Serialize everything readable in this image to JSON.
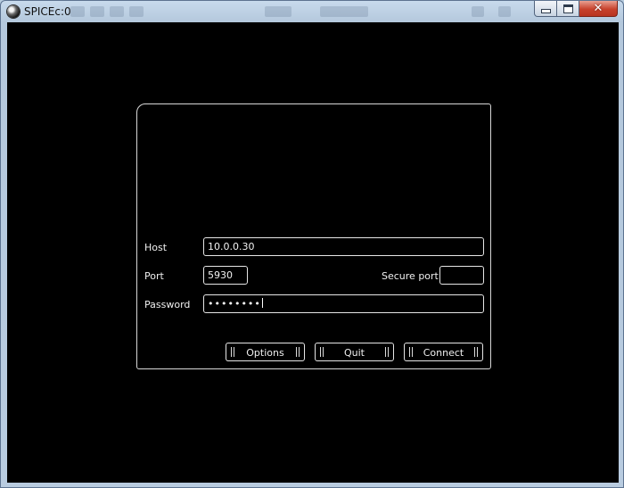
{
  "window": {
    "title": "SPICEc:0"
  },
  "dialog": {
    "host": {
      "label": "Host",
      "value": "10.0.0.30"
    },
    "port": {
      "label": "Port",
      "value": "5930"
    },
    "secure_port": {
      "label": "Secure port",
      "value": ""
    },
    "password": {
      "label": "Password",
      "masked_value": "••••••••"
    },
    "buttons": {
      "options": "Options",
      "quit": "Quit",
      "connect": "Connect"
    }
  },
  "icons": {
    "app": "spice-app-icon",
    "minimize": "minimize-icon",
    "maximize": "maximize-icon",
    "close": "close-icon"
  }
}
